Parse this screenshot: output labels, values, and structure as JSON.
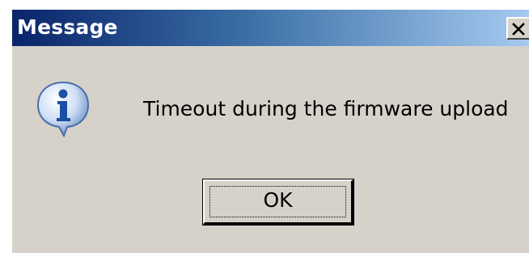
{
  "window": {
    "title": "Message",
    "close_label": "X"
  },
  "dialog": {
    "icon": "info-icon",
    "message": "Timeout during the firmware upload",
    "ok_label": "OK"
  },
  "colors": {
    "titlebar_start": "#0a246a",
    "titlebar_end": "#a6caf0",
    "dialog_bg": "#d6d2ca"
  }
}
